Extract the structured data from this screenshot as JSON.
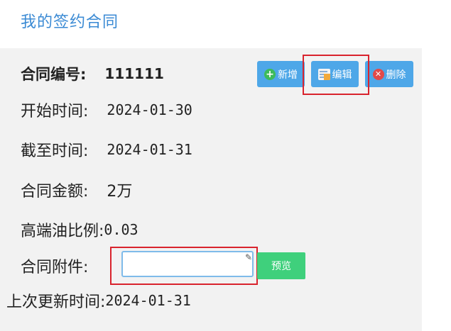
{
  "page": {
    "title": "我的签约合同"
  },
  "toolbar": {
    "add_label": "新增",
    "edit_label": "编辑",
    "delete_label": "删除",
    "add_icon": "plus-circle-icon",
    "edit_icon": "edit-note-icon",
    "delete_icon": "close-circle-icon"
  },
  "contract": {
    "number_label": "合同编号:",
    "number_value": "111111",
    "start_label": "开始时间:",
    "start_value": "2024-01-30",
    "end_label": "截至时间:",
    "end_value": "2024-01-31",
    "amount_label": "合同金额:",
    "amount_value": "2万",
    "ratio_label": "高端油比例:",
    "ratio_value": "0.03",
    "attachment_label": "合同附件:",
    "attachment_value": "",
    "preview_label": "预览",
    "updated_label": "上次更新时间:",
    "updated_value": "2024-01-31"
  },
  "colors": {
    "title": "#3a8ad4",
    "button": "#4ea7e8",
    "preview_button": "#3fd07c",
    "highlight": "#d9232d",
    "panel_bg": "#f2f2f2"
  }
}
